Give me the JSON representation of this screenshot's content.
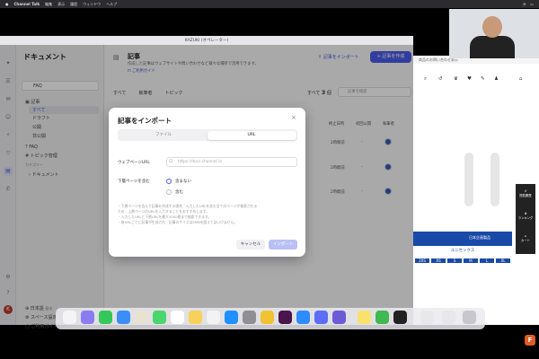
{
  "menubar": {
    "app": "Channel Talk",
    "items": [
      "編集",
      "表示",
      "履歴",
      "ウィンドウ",
      "ヘルプ"
    ]
  },
  "window": {
    "title": "KAZUKI (オペレーター)"
  },
  "sidebar": {
    "title": "ドキュメント",
    "space": "FAQ",
    "section_articles": "記事",
    "all": "すべて",
    "draft": "ドラフト",
    "published": "公開",
    "private": "非公開",
    "faq": "FAQ",
    "topics": "トピック管理",
    "category_label": "カテゴリー",
    "documents": "ドキュメント",
    "lang": "日本語",
    "lang_tag": "基本",
    "space_settings": "スペース設定",
    "guide": "ご利用ガイド"
  },
  "main": {
    "title": "記事",
    "desc": "作成した記事はウェブサイトや問い合わせなど様々な場所で活用できます。",
    "guide_link": "ご利用ガイド",
    "import_button": "記事をインポート",
    "create_button": "+ 記事を作成",
    "filters": [
      "すべて",
      "執筆者",
      "トピック"
    ],
    "count_prefix": "すべて",
    "count": "3",
    "count_suffix": "個",
    "search_placeholder": "記事を検索",
    "columns": [
      "終止日時",
      "初回公開",
      "執筆者"
    ],
    "rows": [
      {
        "date": "2時間前",
        "first": "-"
      },
      {
        "date": "2時間前",
        "first": "-"
      },
      {
        "date": "2時間前",
        "first": "-"
      }
    ]
  },
  "modal": {
    "title": "記事をインポート",
    "close": "×",
    "tab_file": "ファイル",
    "tab_url": "URL",
    "url_label": "ウェブページURL",
    "url_placeholder": "https://docs.channel.io",
    "subpages_label": "下層ページを含む",
    "option_exclude": "含まない",
    "option_include": "含む",
    "notes": [
      "・下層ページを含んで記事を作成する場合、入力したURLを含む全てのページが検索される",
      "ため、上層ページのURLを入力することをおすすめします。",
      "・入力したURLと下層URLを最大1000個まで検索できます。",
      "・各URLごとに記事が生成され、記事のサイズは5MBを超えてはいけません。"
    ],
    "cancel": "キャンセル",
    "import": "インポート"
  },
  "web": {
    "tab_text": "商品のお問い合わせ表示",
    "band_title": "ユニセックス",
    "band_sub": "日本企画製品",
    "sizes": [
      "2XS",
      "XS",
      "S",
      "M",
      "L",
      "XL"
    ],
    "widget": [
      "閲覧履歴",
      "ランキング",
      "カート"
    ]
  },
  "brand": "F"
}
